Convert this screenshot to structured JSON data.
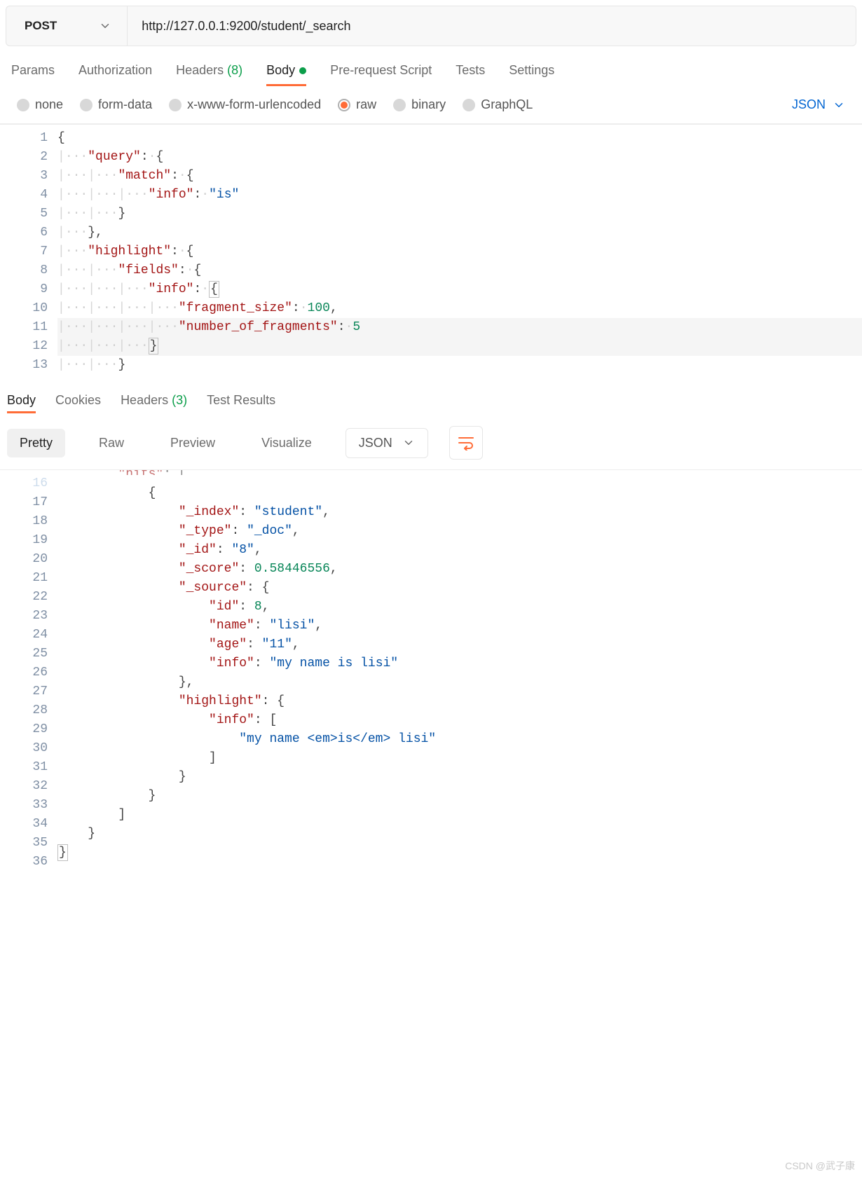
{
  "request": {
    "method": "POST",
    "url": "http://127.0.0.1:9200/student/_search"
  },
  "requestTabs": [
    {
      "label": "Params",
      "active": false
    },
    {
      "label": "Authorization",
      "active": false
    },
    {
      "label": "Headers",
      "active": false,
      "count": "(8)"
    },
    {
      "label": "Body",
      "active": true,
      "indicator": true
    },
    {
      "label": "Pre-request Script",
      "active": false
    },
    {
      "label": "Tests",
      "active": false
    },
    {
      "label": "Settings",
      "active": false
    }
  ],
  "bodyTypes": [
    {
      "label": "none",
      "selected": false
    },
    {
      "label": "form-data",
      "selected": false
    },
    {
      "label": "x-www-form-urlencoded",
      "selected": false
    },
    {
      "label": "raw",
      "selected": true
    },
    {
      "label": "binary",
      "selected": false
    },
    {
      "label": "GraphQL",
      "selected": false
    }
  ],
  "language": "JSON",
  "requestBody": {
    "lineStart": 1,
    "lineEnd": 13,
    "json": {
      "query": {
        "match": {
          "info": "is"
        }
      },
      "highlight": {
        "fields": {
          "info": {
            "fragment_size": 100,
            "number_of_fragments": 5
          }
        }
      }
    },
    "tokens": {
      "query": "\"query\"",
      "match": "\"match\"",
      "info": "\"info\"",
      "is": "\"is\"",
      "highlight": "\"highlight\"",
      "fields": "\"fields\"",
      "fragment_size": "\"fragment_size\"",
      "fragment_size_val": "100",
      "number_of_fragments": "\"number_of_fragments\"",
      "number_of_fragments_val": "5"
    }
  },
  "responseTabs": [
    {
      "label": "Body",
      "active": true
    },
    {
      "label": "Cookies",
      "active": false
    },
    {
      "label": "Headers",
      "active": false,
      "count": "(3)"
    },
    {
      "label": "Test Results",
      "active": false
    }
  ],
  "viewModes": {
    "modes": [
      {
        "label": "Pretty",
        "active": true
      },
      {
        "label": "Raw",
        "active": false
      },
      {
        "label": "Preview",
        "active": false
      },
      {
        "label": "Visualize",
        "active": false
      }
    ],
    "lang": "JSON"
  },
  "responseBody": {
    "lineStart": 17,
    "lineEnd": 36,
    "topLineFragment": {
      "key": "\"hits\"",
      "suffix": ": ["
    },
    "hit": {
      "_index_key": "\"_index\"",
      "_index_val": "\"student\"",
      "_type_key": "\"_type\"",
      "_type_val": "\"_doc\"",
      "_id_key": "\"_id\"",
      "_id_val": "\"8\"",
      "_score_key": "\"_score\"",
      "_score_val": "0.58446556",
      "_source_key": "\"_source\"",
      "source": {
        "id_key": "\"id\"",
        "id_val": "8",
        "name_key": "\"name\"",
        "name_val": "\"lisi\"",
        "age_key": "\"age\"",
        "age_val": "\"11\"",
        "info_key": "\"info\"",
        "info_val": "\"my name is lisi\""
      },
      "highlight_key": "\"highlight\"",
      "highlight": {
        "info_key": "\"info\"",
        "info_arr_val": "\"my name <em>is</em> lisi\""
      }
    }
  },
  "watermark": "CSDN @武子康"
}
